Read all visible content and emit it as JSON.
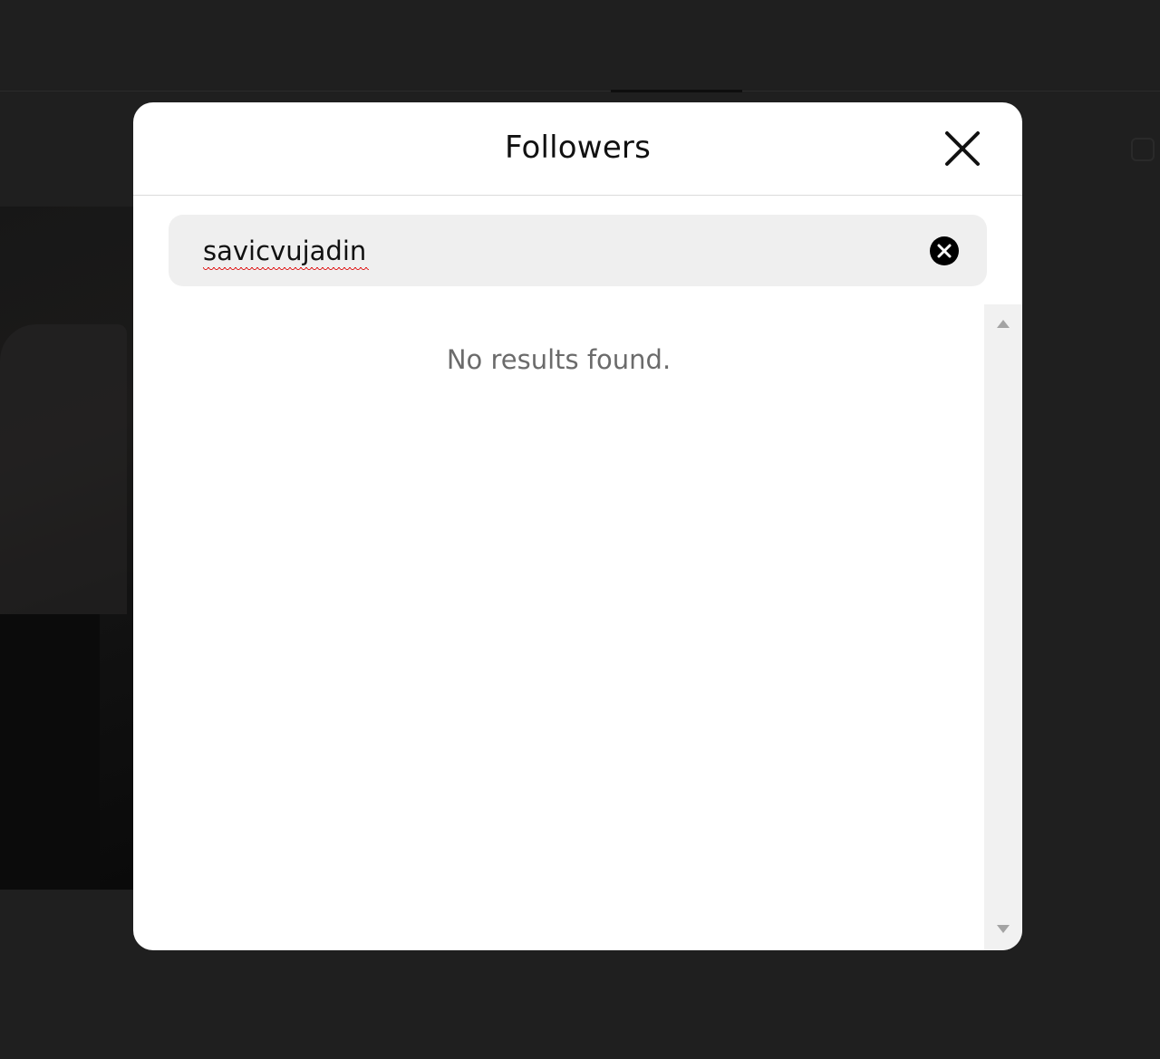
{
  "modal": {
    "title": "Followers"
  },
  "search": {
    "value": "savicvujadin",
    "placeholder": "Search"
  },
  "results": {
    "empty_message": "No results found."
  },
  "icons": {
    "close": "close-icon",
    "clear": "clear-search-icon",
    "scroll_up": "scroll-up-arrow-icon",
    "scroll_down": "scroll-down-arrow-icon"
  },
  "colors": {
    "backdrop": "#1f1f1f",
    "modal_bg": "#ffffff",
    "search_bg": "#efefef",
    "empty_text": "#6b6b6b",
    "title_text": "#111111"
  }
}
